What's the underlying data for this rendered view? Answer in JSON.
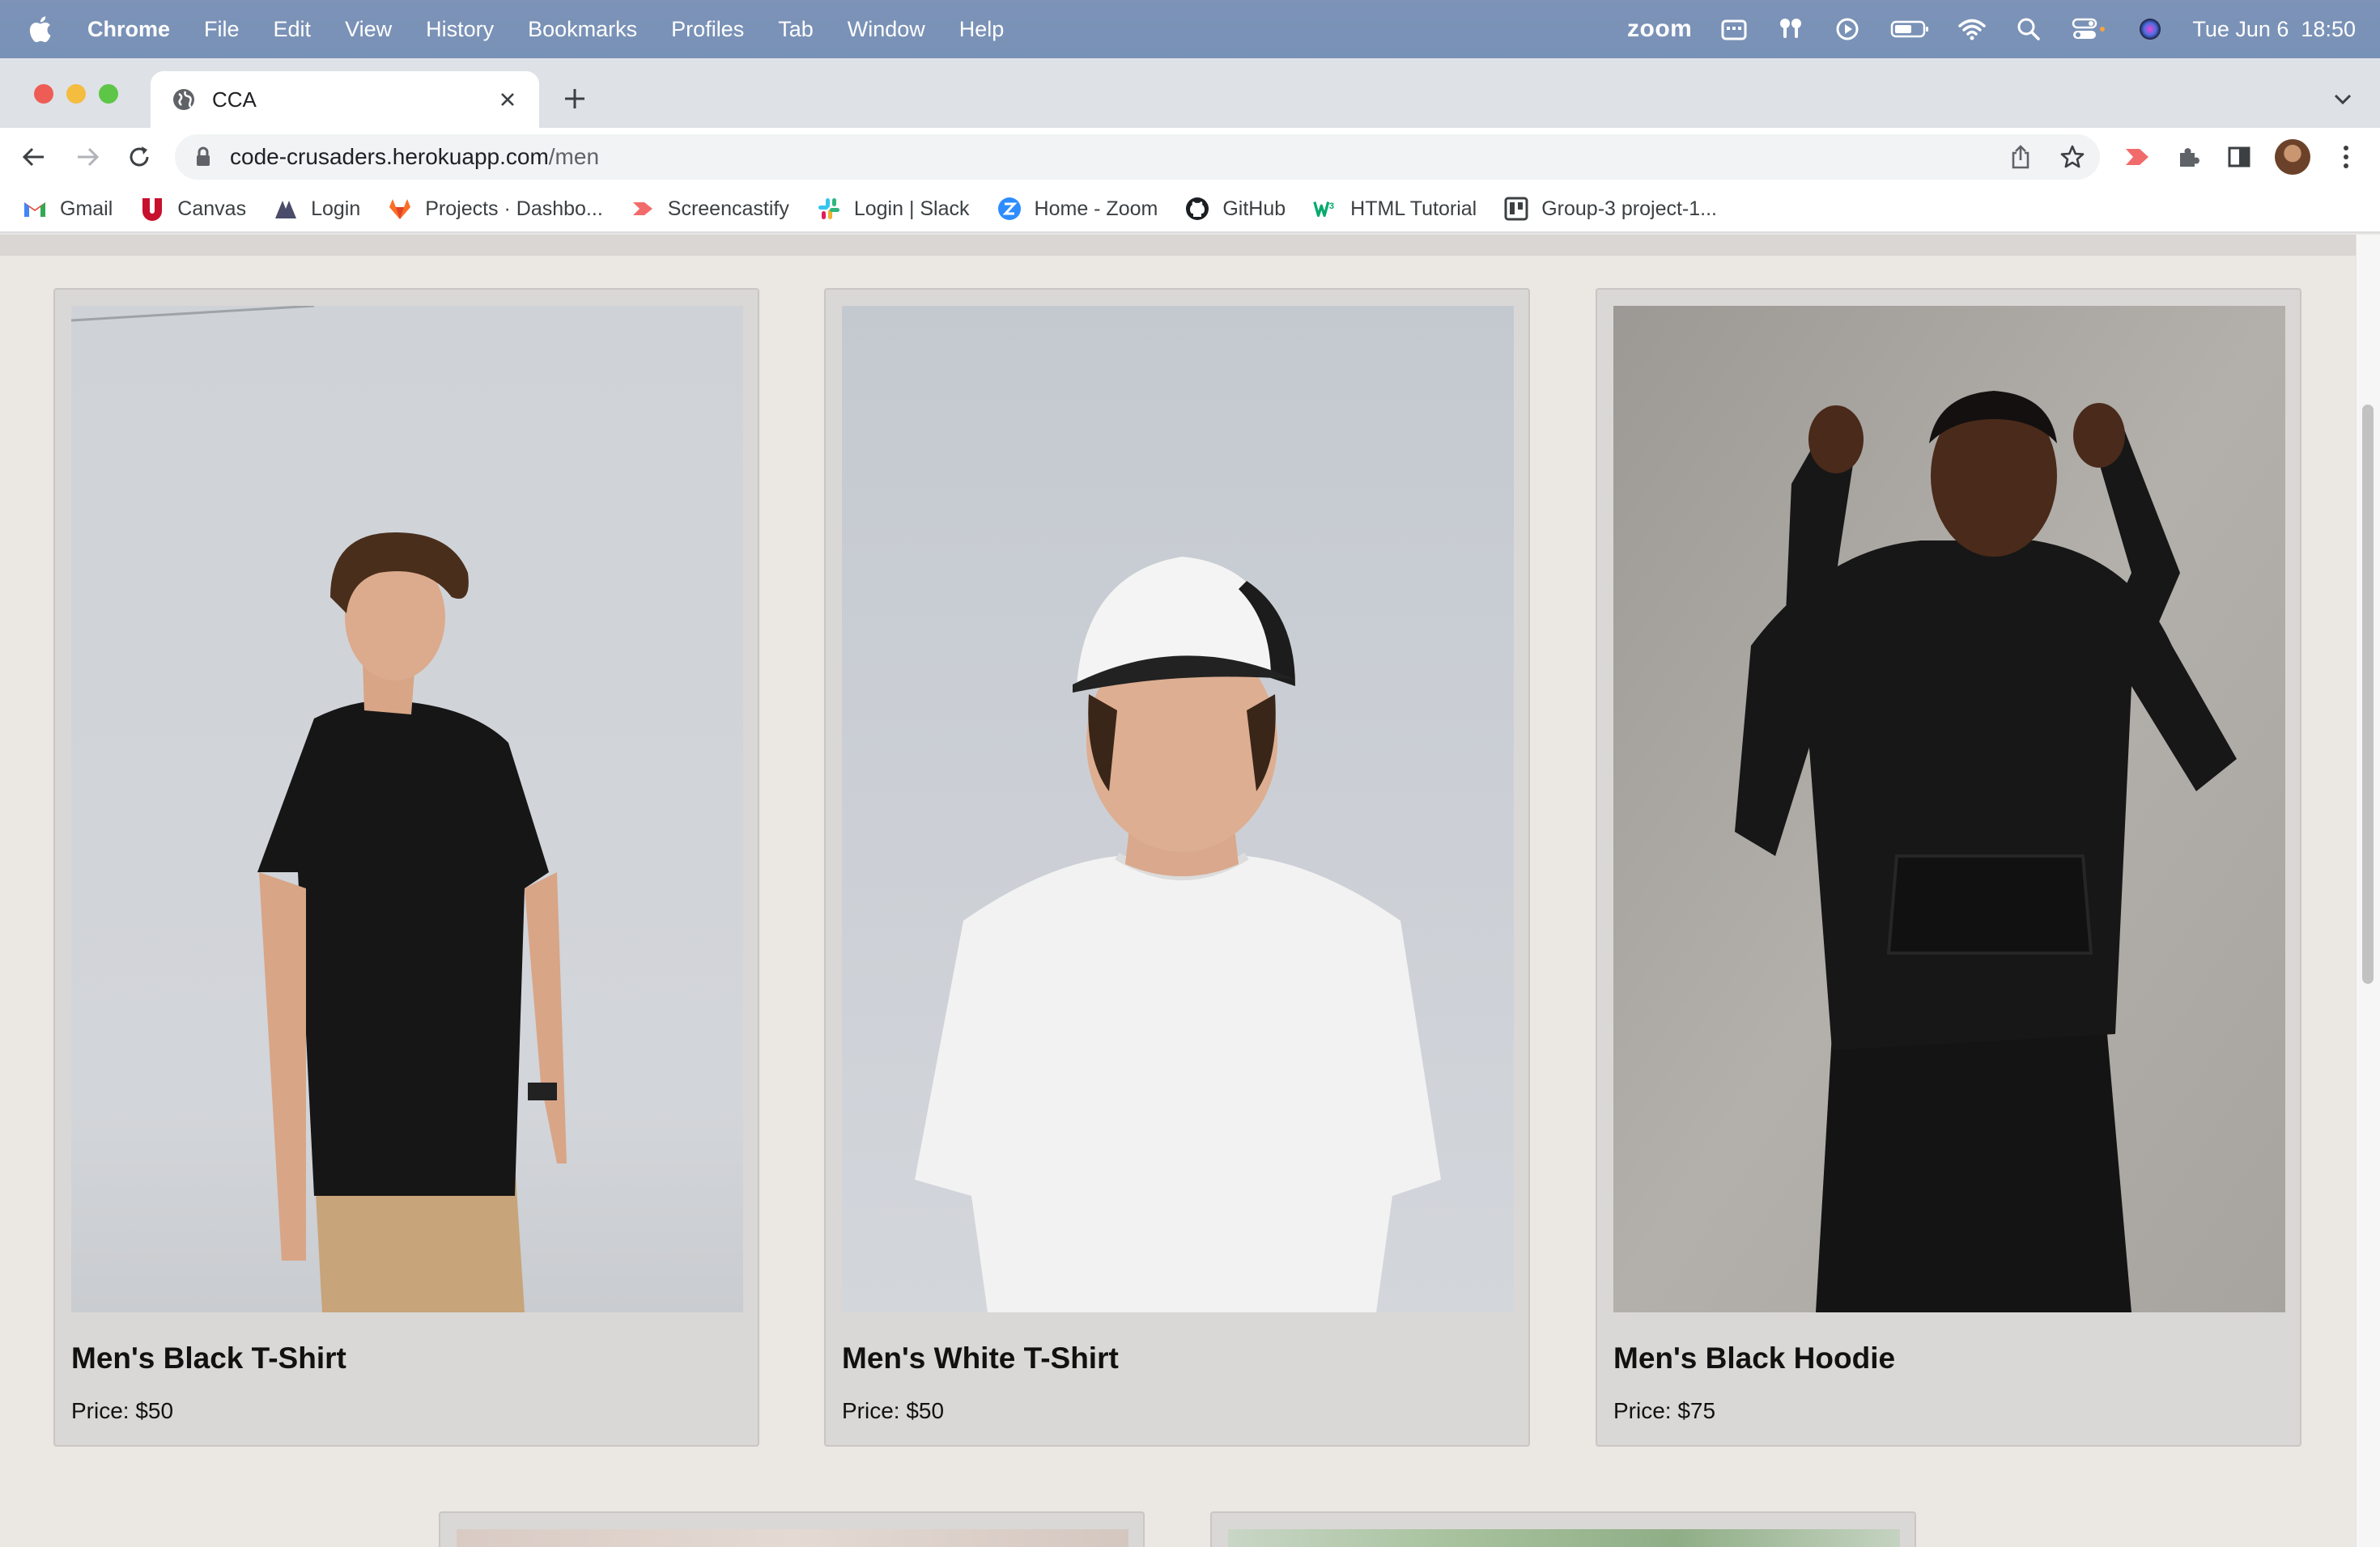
{
  "menubar": {
    "app_name": "Chrome",
    "items": [
      "File",
      "Edit",
      "View",
      "History",
      "Bookmarks",
      "Profiles",
      "Tab",
      "Window",
      "Help"
    ],
    "zoom_label": "zoom",
    "datetime": "Tue Jun 6  18:50"
  },
  "browser": {
    "tab_title": "CCA",
    "url_host": "code-crusaders.herokuapp.com",
    "url_path": "/men",
    "bookmarks": [
      {
        "label": "Gmail",
        "icon": "gmail-icon"
      },
      {
        "label": "Canvas",
        "icon": "canvas-icon"
      },
      {
        "label": "Login",
        "icon": "login-icon"
      },
      {
        "label": "Projects · Dashbo...",
        "icon": "gitlab-icon"
      },
      {
        "label": "Screencastify",
        "icon": "screencastify-icon"
      },
      {
        "label": "Login | Slack",
        "icon": "slack-icon"
      },
      {
        "label": "Home - Zoom",
        "icon": "zoom-icon"
      },
      {
        "label": "GitHub",
        "icon": "github-icon"
      },
      {
        "label": "HTML Tutorial",
        "icon": "w3schools-icon"
      },
      {
        "label": "Group-3 project-1...",
        "icon": "trello-icon"
      }
    ]
  },
  "products": [
    {
      "name": "Men's Black T-Shirt",
      "price": "Price: $50"
    },
    {
      "name": "Men's White T-Shirt",
      "price": "Price: $50"
    },
    {
      "name": "Men's Black Hoodie",
      "price": "Price: $75"
    }
  ],
  "colors": {
    "menubar": "#7891b6",
    "page_background": "#ebe7e3",
    "card_background": "#dad8d6"
  }
}
